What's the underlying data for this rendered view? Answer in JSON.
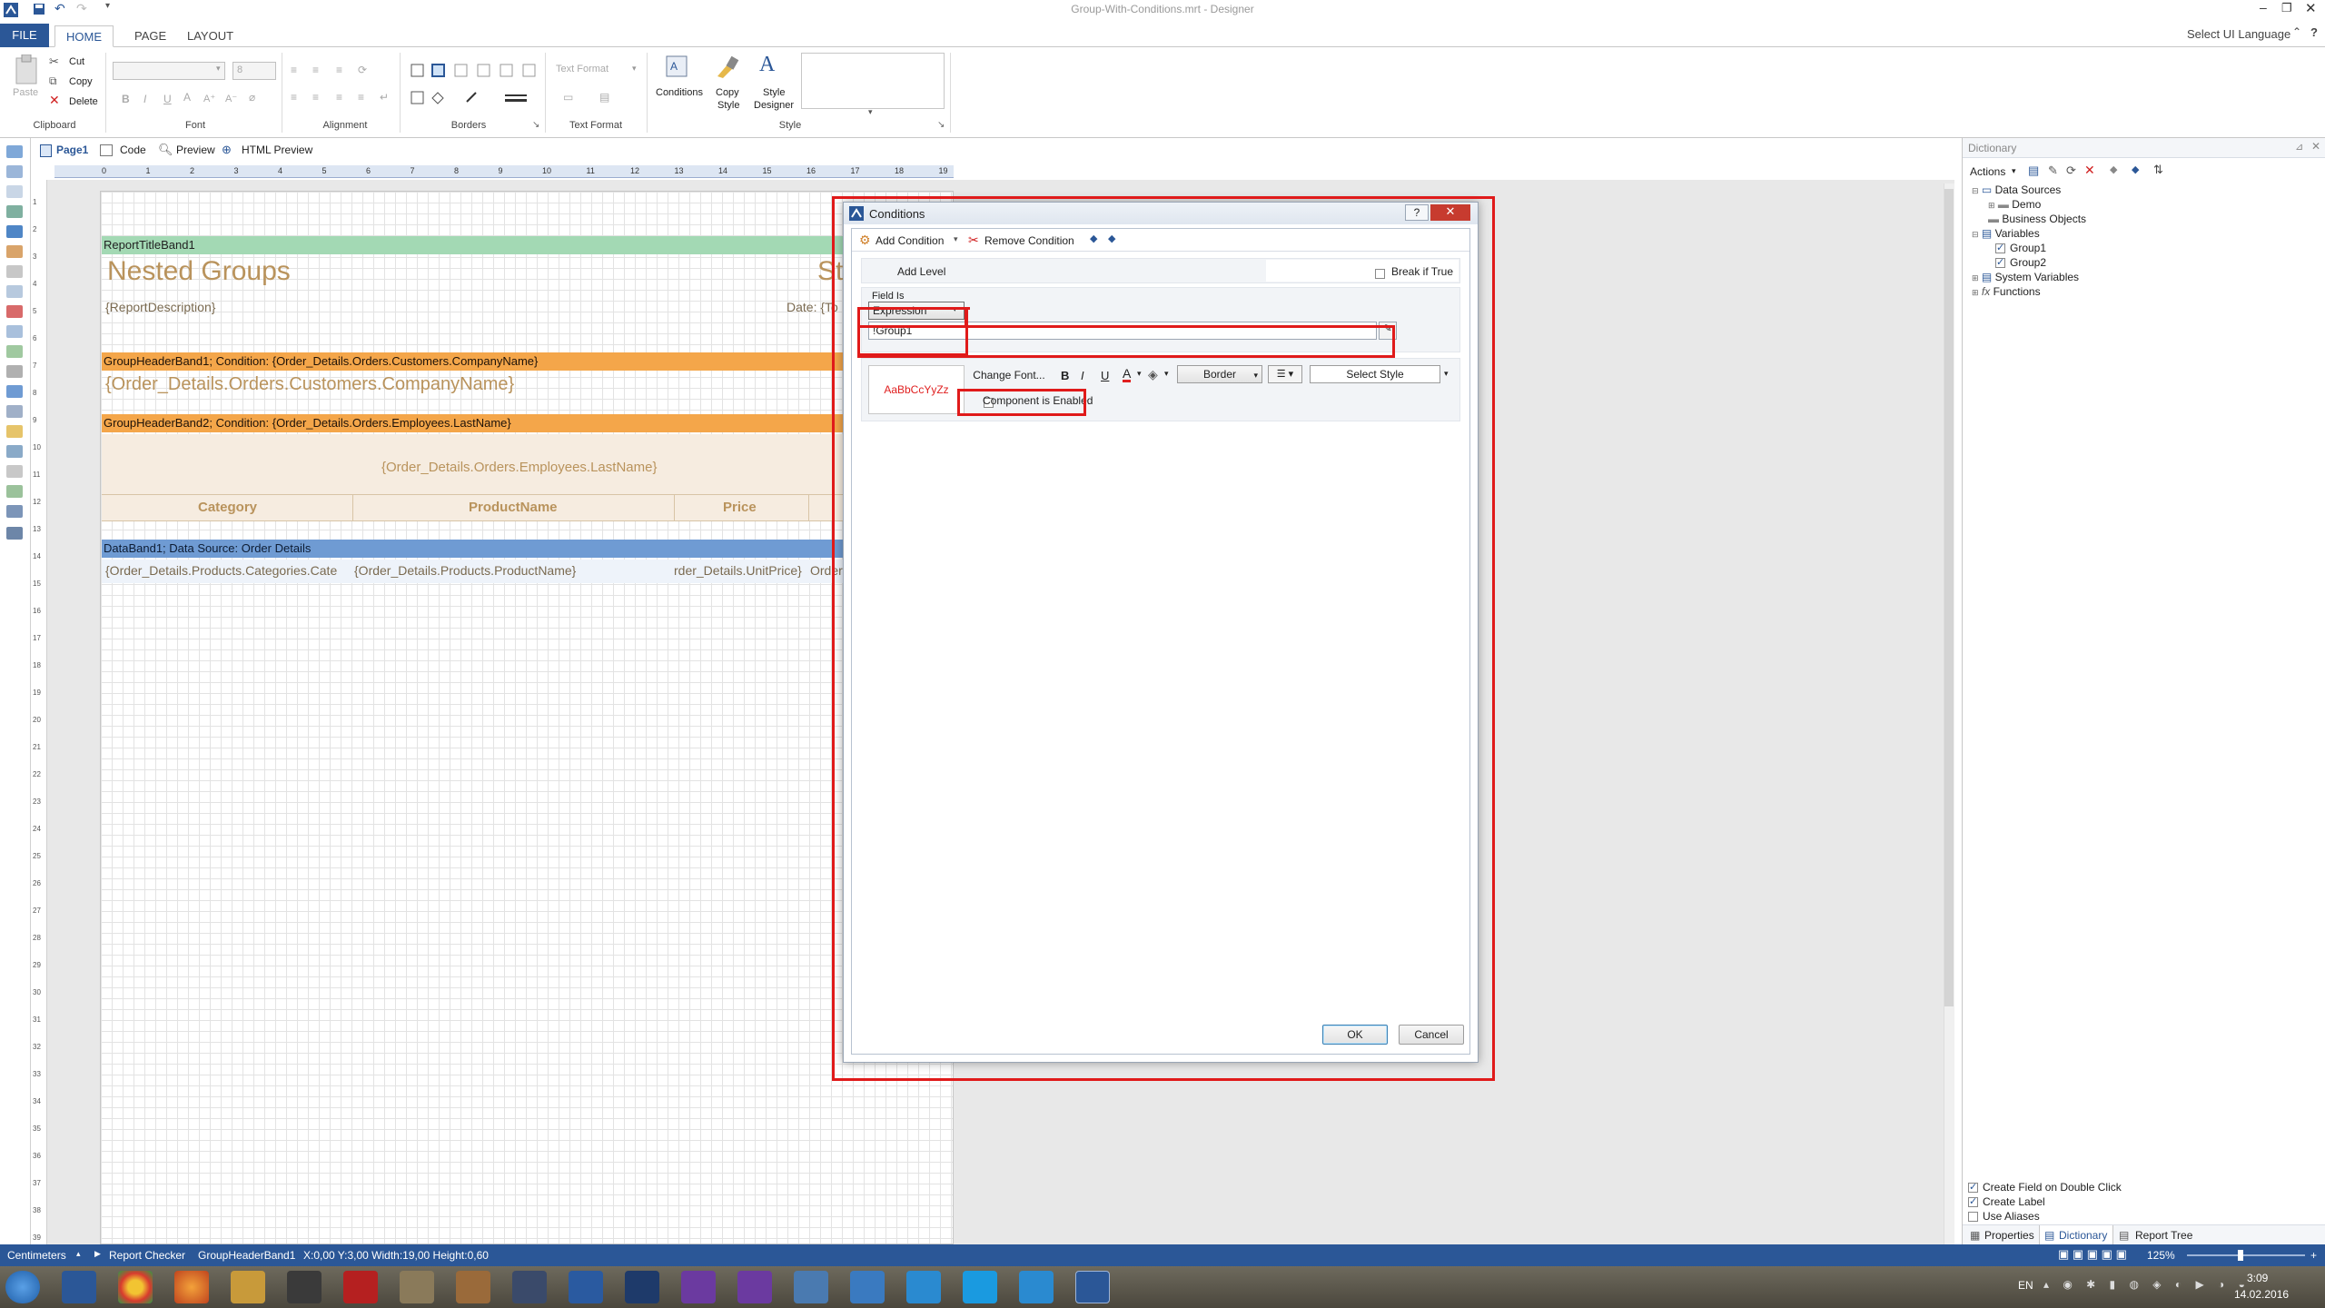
{
  "window": {
    "title": "Group-With-Conditions.mrt - Designer",
    "select_ui_language": "Select UI Language"
  },
  "ribbon": {
    "tabs": [
      "FILE",
      "HOME",
      "PAGE",
      "LAYOUT"
    ],
    "clipboard": {
      "paste": "Paste",
      "cut": "Cut",
      "copy": "Copy",
      "delete": "Delete",
      "label": "Clipboard"
    },
    "font": {
      "size": "8",
      "label": "Font"
    },
    "alignment": {
      "label": "Alignment"
    },
    "borders": {
      "label": "Borders"
    },
    "text_format": {
      "placeholder": "Text Format",
      "label": "Text Format"
    },
    "style": {
      "conditions": "Conditions",
      "copy_style_1": "Copy",
      "copy_style_2": "Style",
      "style_designer_1": "Style",
      "style_designer_2": "Designer",
      "label": "Style"
    }
  },
  "page_tabs": [
    "Page1",
    "Code",
    "Preview",
    "HTML Preview"
  ],
  "ruler_numbers": [
    "0",
    "1",
    "2",
    "3",
    "4",
    "5",
    "6",
    "7",
    "8",
    "9",
    "10",
    "11",
    "12",
    "13",
    "14",
    "15",
    "16",
    "17",
    "18",
    "19"
  ],
  "vruler_numbers": [
    "1",
    "2",
    "3",
    "4",
    "5",
    "6",
    "7",
    "8",
    "9",
    "10",
    "11",
    "12",
    "13",
    "14",
    "15",
    "16",
    "17",
    "18",
    "19",
    "20",
    "21",
    "22",
    "23",
    "24",
    "25",
    "26",
    "27",
    "28",
    "29",
    "30",
    "31",
    "32",
    "33",
    "34",
    "35",
    "36",
    "37",
    "38",
    "39"
  ],
  "report": {
    "title_band": "ReportTitleBand1",
    "title_text": "Nested Groups",
    "title_right": "St",
    "description": "{ReportDescription}",
    "date": "Date: {To",
    "group1_band": "GroupHeaderBand1; Condition: {Order_Details.Orders.Customers.CompanyName}",
    "group1_text": "{Order_Details.Orders.Customers.CompanyName}",
    "group2_band": "GroupHeaderBand2; Condition: {Order_Details.Orders.Employees.LastName}",
    "group2_text": "{Order_Details.Orders.Employees.LastName}",
    "columns": [
      "Category",
      "ProductName",
      "Price"
    ],
    "data_band": "DataBand1; Data Source: Order Details",
    "data_cells": [
      "{Order_Details.Products.Categories.Cate",
      "{Order_Details.Products.ProductName}",
      "rder_Details.UnitPrice}",
      "Order"
    ]
  },
  "dialog": {
    "title": "Conditions",
    "add_condition": "Add Condition",
    "remove_condition": "Remove Condition",
    "add_level": "Add Level",
    "break_if_true": "Break if True",
    "field_is_label": "Field Is",
    "field_is_value": "Expression",
    "expression_value": "!Group1",
    "sample_text": "AaBbCcYyZz",
    "change_font": "Change Font...",
    "border": "Border",
    "select_style": "Select Style",
    "component_enabled": "Component is Enabled",
    "ok": "OK",
    "cancel": "Cancel"
  },
  "dictionary": {
    "title": "Dictionary",
    "actions": "Actions",
    "tree": [
      "Data Sources",
      "Demo",
      "Business Objects",
      "Variables",
      "Group1",
      "Group2",
      "System Variables",
      "Functions"
    ],
    "options": [
      "Create Field on Double Click",
      "Create Label",
      "Use Aliases"
    ],
    "tabs": [
      "Properties",
      "Dictionary",
      "Report Tree"
    ]
  },
  "status": {
    "units": "Centimeters",
    "report_checker": "Report Checker",
    "component": "GroupHeaderBand1",
    "position": "X:0,00  Y:3,00  Width:19,00  Height:0,60",
    "zoom": "125%"
  },
  "taskbar": {
    "lang": "EN",
    "time": "3:09",
    "date": "14.02.2016"
  },
  "colors": {
    "accent": "#2b5797",
    "title_band": "#a3d9b4",
    "group_band": "#f4a64a",
    "data_band": "#6f9bd3",
    "highlight_red": "#e01a1a"
  }
}
